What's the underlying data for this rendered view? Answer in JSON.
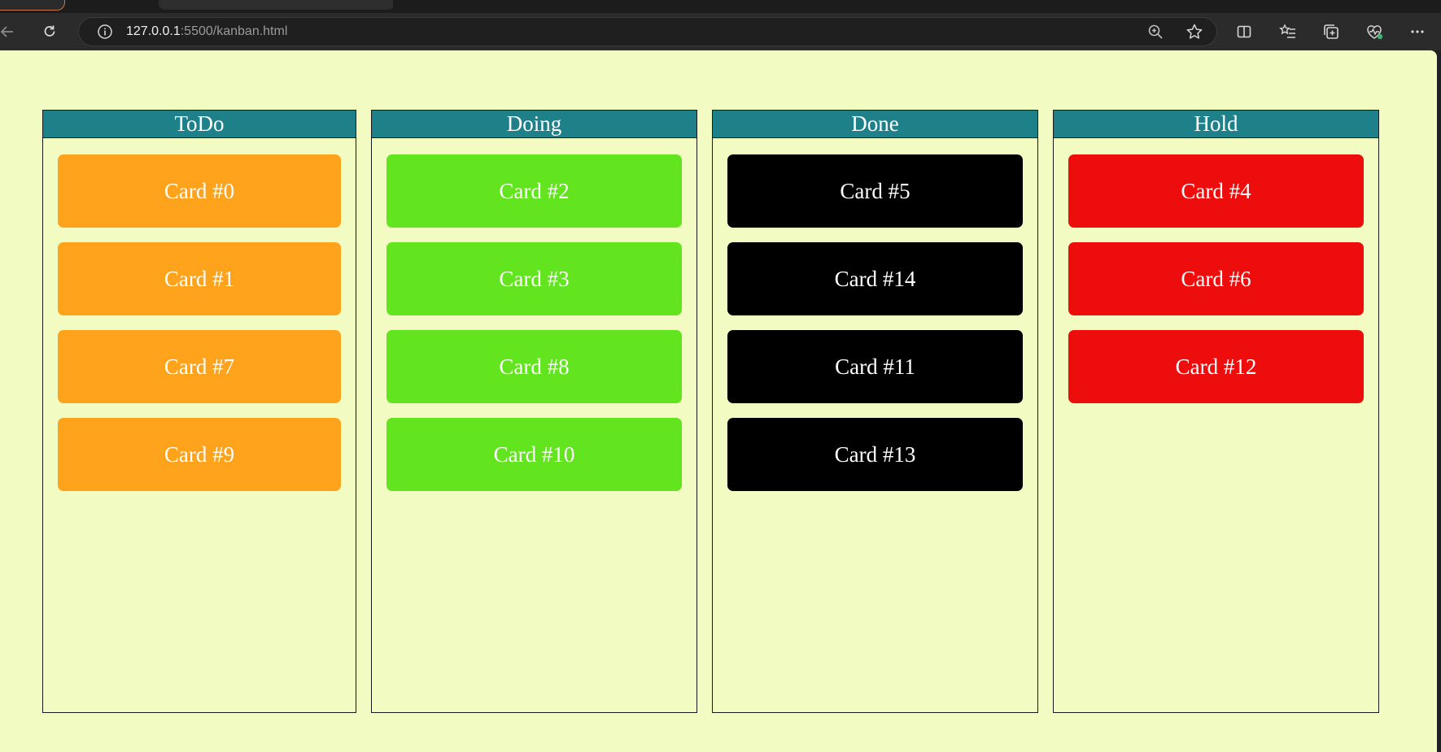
{
  "browser": {
    "url_host": "127.0.0.1",
    "url_rest": ":5500/kanban.html",
    "icons": {
      "back": "back-arrow-icon",
      "reload": "reload-icon",
      "site_info": "info-icon",
      "zoom": "zoom-in-icon",
      "favorite": "star-icon",
      "split": "split-screen-icon",
      "favorites": "favorites-list-icon",
      "collections": "collections-icon",
      "health": "browser-essentials-icon",
      "menu": "more-menu-icon"
    }
  },
  "page": {
    "background": "#f2fcc2",
    "header_color": "#1e818a"
  },
  "board": {
    "columns": [
      {
        "title": "ToDo",
        "color": "#ffa21c",
        "cards": [
          "Card #0",
          "Card #1",
          "Card #7",
          "Card #9"
        ]
      },
      {
        "title": "Doing",
        "color": "#62e41f",
        "cards": [
          "Card #2",
          "Card #3",
          "Card #8",
          "Card #10"
        ]
      },
      {
        "title": "Done",
        "color": "#000000",
        "cards": [
          "Card #5",
          "Card #14",
          "Card #11",
          "Card #13"
        ]
      },
      {
        "title": "Hold",
        "color": "#ee0d0d",
        "cards": [
          "Card #4",
          "Card #6",
          "Card #12"
        ]
      }
    ]
  }
}
